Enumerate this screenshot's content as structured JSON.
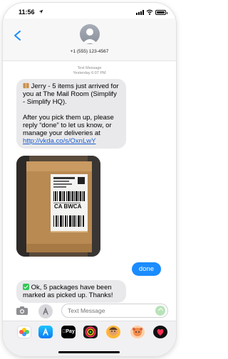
{
  "status_bar": {
    "time": "11:56"
  },
  "header": {
    "back_icon": "chevron-left-icon",
    "contact": "+1 (555) 123-4567"
  },
  "thread": {
    "meta_service": "Text Message",
    "meta_timestamp": "Yesterday 6:07 PM",
    "message_1": {
      "line_1": "Jerry - 5 items just arrived for you at The Mail Room (Simplify - Simplify HQ).",
      "line_2": "After you pick them up, please reply “done” to let us know, or manage your deliveries at",
      "link": "http://vkda.co/s/OxnLwY"
    },
    "photo": {
      "label": "CA BWCA"
    },
    "reply": "done",
    "message_3": "Ok, 5 packages have been marked as picked up. Thanks!"
  },
  "input": {
    "placeholder": "Text Message"
  },
  "drawer": {
    "pay_label": "Pay"
  },
  "colors": {
    "imessage_blue": "#1a8cff",
    "incoming_gray": "#e9e9eb",
    "link": "#1a5ccf",
    "check_green": "#34c759"
  }
}
